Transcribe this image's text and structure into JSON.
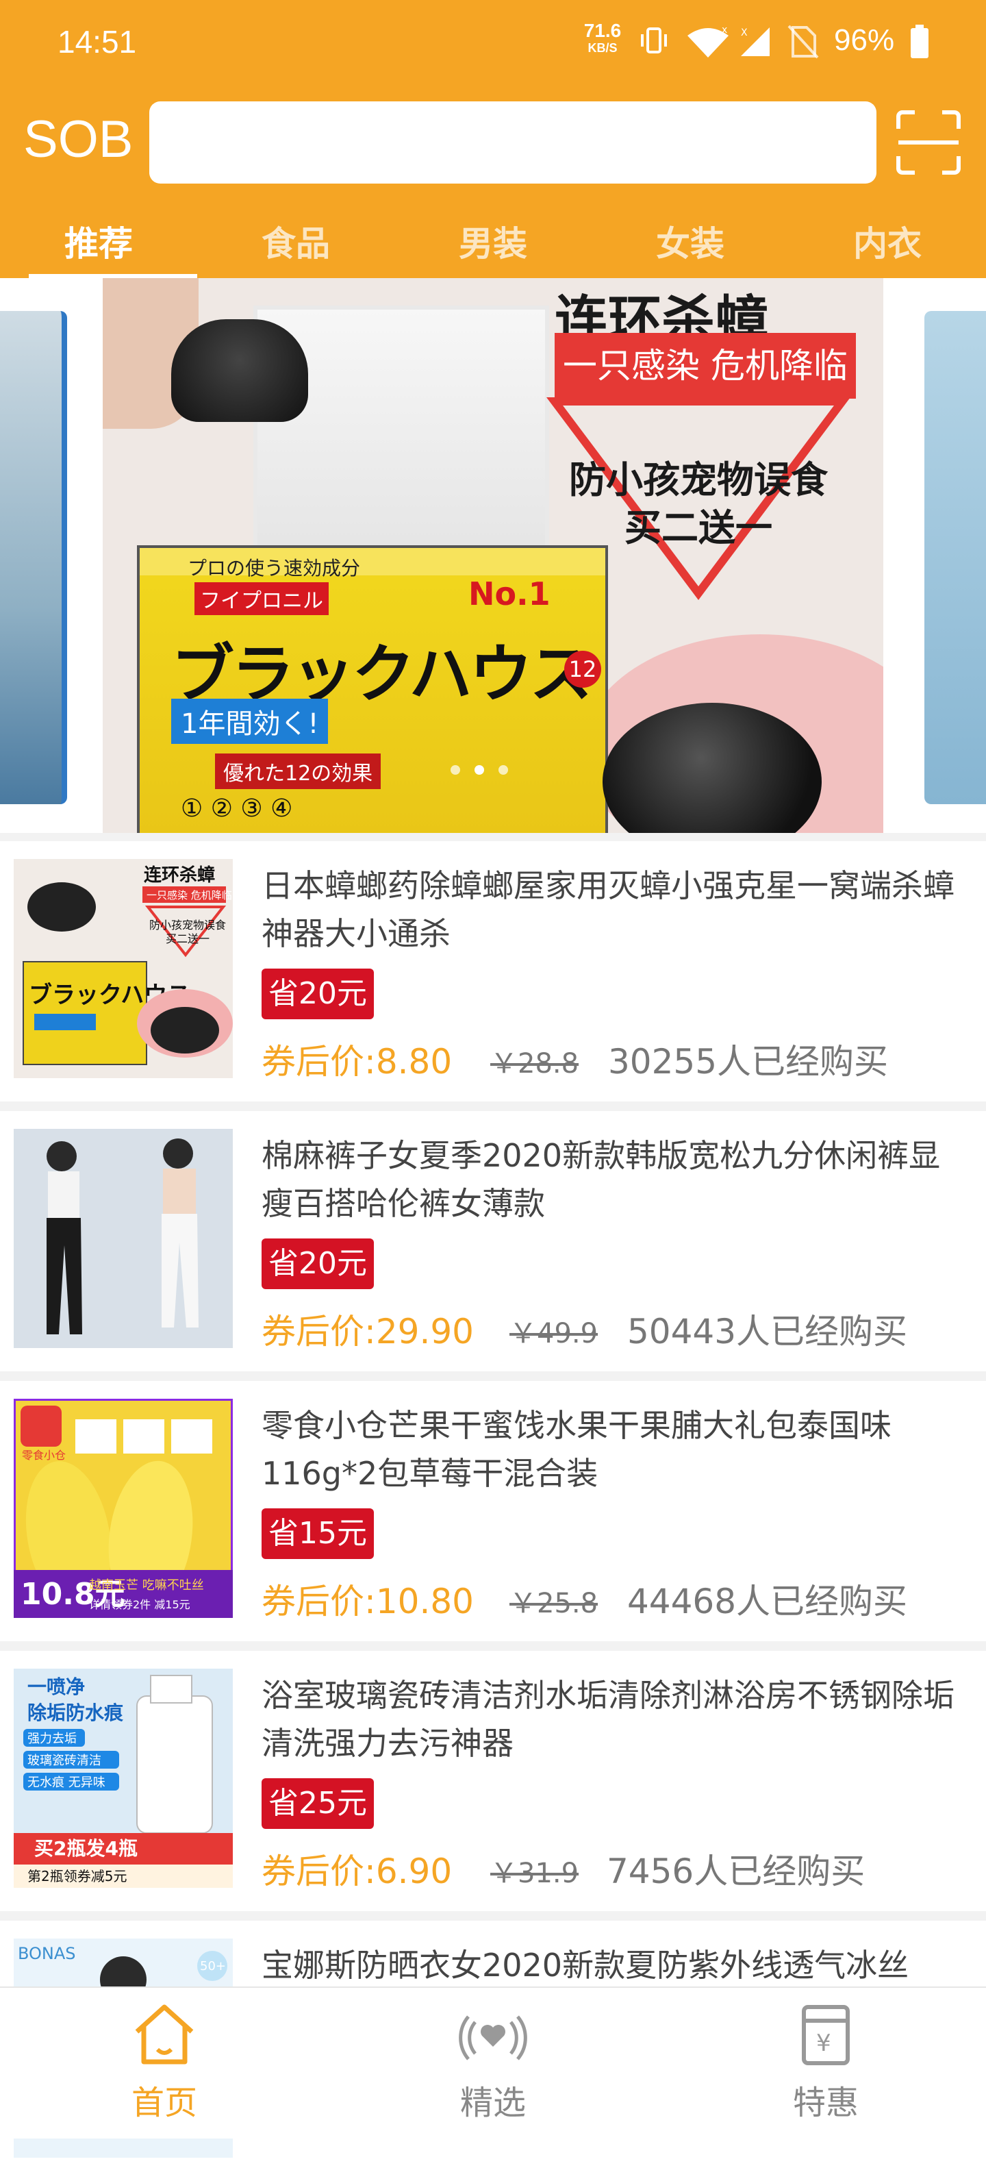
{
  "status_bar": {
    "time": "14:51",
    "net_speed_value": "71.6",
    "net_speed_unit": "KB/S",
    "battery": "96%"
  },
  "header": {
    "logo": "SOB",
    "search_placeholder": "",
    "accent_color": "#f5a524"
  },
  "tabs": [
    {
      "label": "推荐",
      "active": true
    },
    {
      "label": "食品"
    },
    {
      "label": "男装"
    },
    {
      "label": "女装"
    },
    {
      "label": "内衣"
    }
  ],
  "banner": {
    "title": "连环杀蟑",
    "subtitle": "一只感染 危机降临",
    "line1": "防小孩宠物误食",
    "line2": "买二送一",
    "box_jp1": "プロの使う速効成分",
    "box_jp2": "フイプロニル",
    "box_brand": "ブラックハウス",
    "box_blue": "1年間効く!",
    "box_red": "優れた12の効果",
    "box_no1": "No.1",
    "box_12": "12",
    "box_nums": "① ② ③ ④",
    "page_count": 5,
    "active_page": 2
  },
  "products": [
    {
      "title": "日本蟑螂药除蟑螂屋家用灭蟑小强克星一窝端杀蟑神器大小通杀",
      "save": "省20元",
      "price": "券后价:8.80",
      "original": "￥28.8",
      "sold": "30255人已经购买",
      "thumb_text1": "连环杀蟑",
      "thumb_text2": "一只感染 危机降临",
      "thumb_text3": "防小孩宠物误食",
      "thumb_text4": "买二送一"
    },
    {
      "title": "棉麻裤子女夏季2020新款韩版宽松九分休闲裤显瘦百搭哈伦裤女薄款",
      "save": "省20元",
      "price": "券后价:29.90",
      "original": "￥49.9",
      "sold": "50443人已经购买"
    },
    {
      "title": "零食小仓芒果干蜜饯水果干果脯大礼包泰国味116g*2包草莓干混合装",
      "save": "省15元",
      "price": "券后价:10.80",
      "original": "￥25.8",
      "sold": "44468人已经购买",
      "thumb_text1": "零食小仓",
      "thumb_text2": "越南玉芒 吃嘛不吐丝",
      "thumb_text3": "10.8元",
      "thumb_text4": "详情领券2件 减15元"
    },
    {
      "title": "浴室玻璃瓷砖清洁剂水垢清除剂淋浴房不锈钢除垢清洗强力去污神器",
      "save": "省25元",
      "price": "券后价:6.90",
      "original": "￥31.9",
      "sold": "7456人已经购买",
      "thumb_text1": "一喷净",
      "thumb_text2": "除垢防水痕",
      "thumb_text3": "强力去垢",
      "thumb_text4": "玻璃瓷砖清洁",
      "thumb_text5": "无水痕 无异味",
      "thumb_text6": "买2瓶发4瓶",
      "thumb_text7": "第2瓶领券减5元"
    },
    {
      "title": "宝娜斯防晒衣女2020新款夏防紫外线透气冰丝",
      "thumb_text1": "BONAS",
      "thumb_text2": "50+"
    }
  ],
  "bottom_nav": [
    {
      "label": "首页",
      "active": true
    },
    {
      "label": "精选"
    },
    {
      "label": "特惠"
    }
  ]
}
